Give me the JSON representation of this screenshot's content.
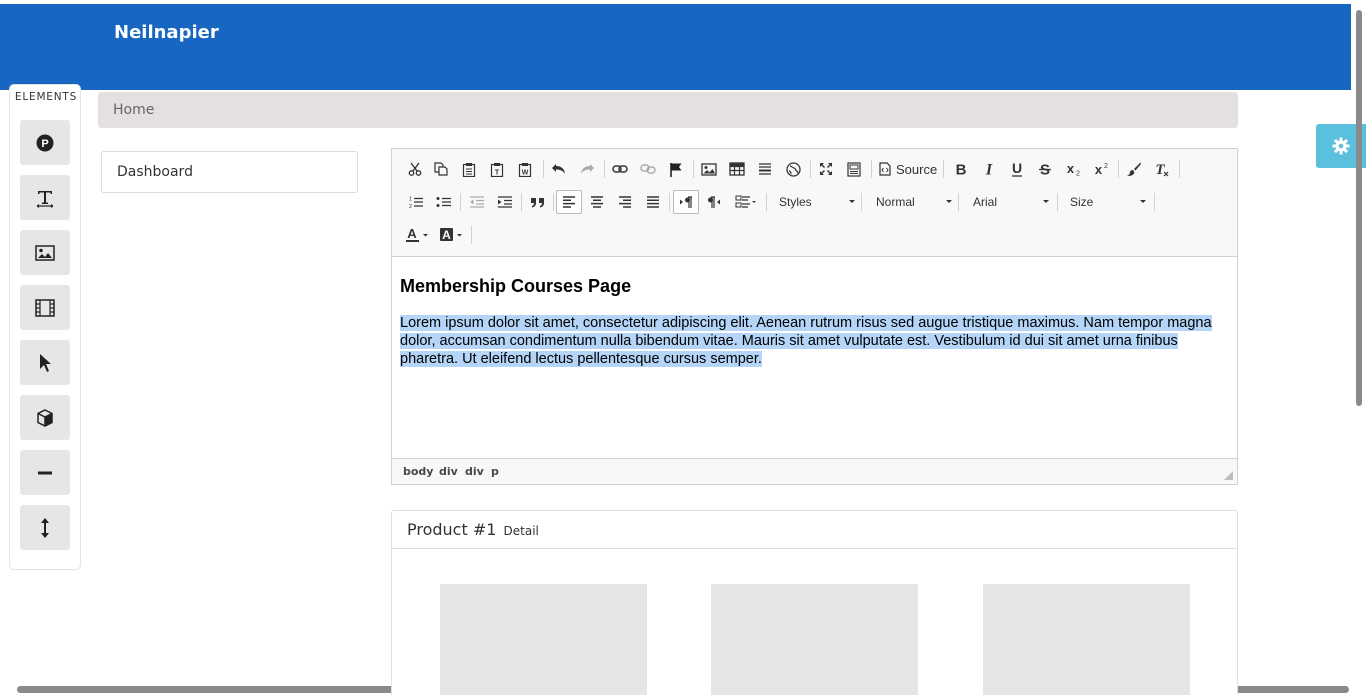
{
  "header": {
    "brand": "Neilnapier"
  },
  "elements_panel": {
    "title": "ELEMENTS",
    "items": [
      "paragraph-icon",
      "text-icon",
      "image-icon",
      "video-icon",
      "pointer-icon",
      "box-icon",
      "divider-icon",
      "spacer-icon"
    ]
  },
  "breadcrumb": {
    "home": "Home"
  },
  "sidebar": {
    "dashboard": "Dashboard"
  },
  "editor": {
    "toolbar": {
      "source_label": "Source",
      "styles": "Styles",
      "format": "Normal",
      "font": "Arial",
      "size": "Size"
    },
    "heading": "Membership Courses Page",
    "paragraph": "Lorem ipsum dolor sit amet, consectetur adipiscing elit. Aenean rutrum risus sed augue tristique maximus. Nam tempor magna dolor, accumsan condimentum nulla bibendum vitae. Mauris sit amet vulputate est. Vestibulum id dui sit amet urna finibus pharetra. Ut eleifend lectus pellentesque cursus semper.",
    "path": [
      "body",
      "div",
      "div",
      "p"
    ]
  },
  "product": {
    "title": "Product #1",
    "subtitle": "Detail"
  },
  "colors": {
    "header_bg": "#1766c2",
    "settings_tab": "#5bc0de",
    "selection": "#b4d4f8"
  }
}
